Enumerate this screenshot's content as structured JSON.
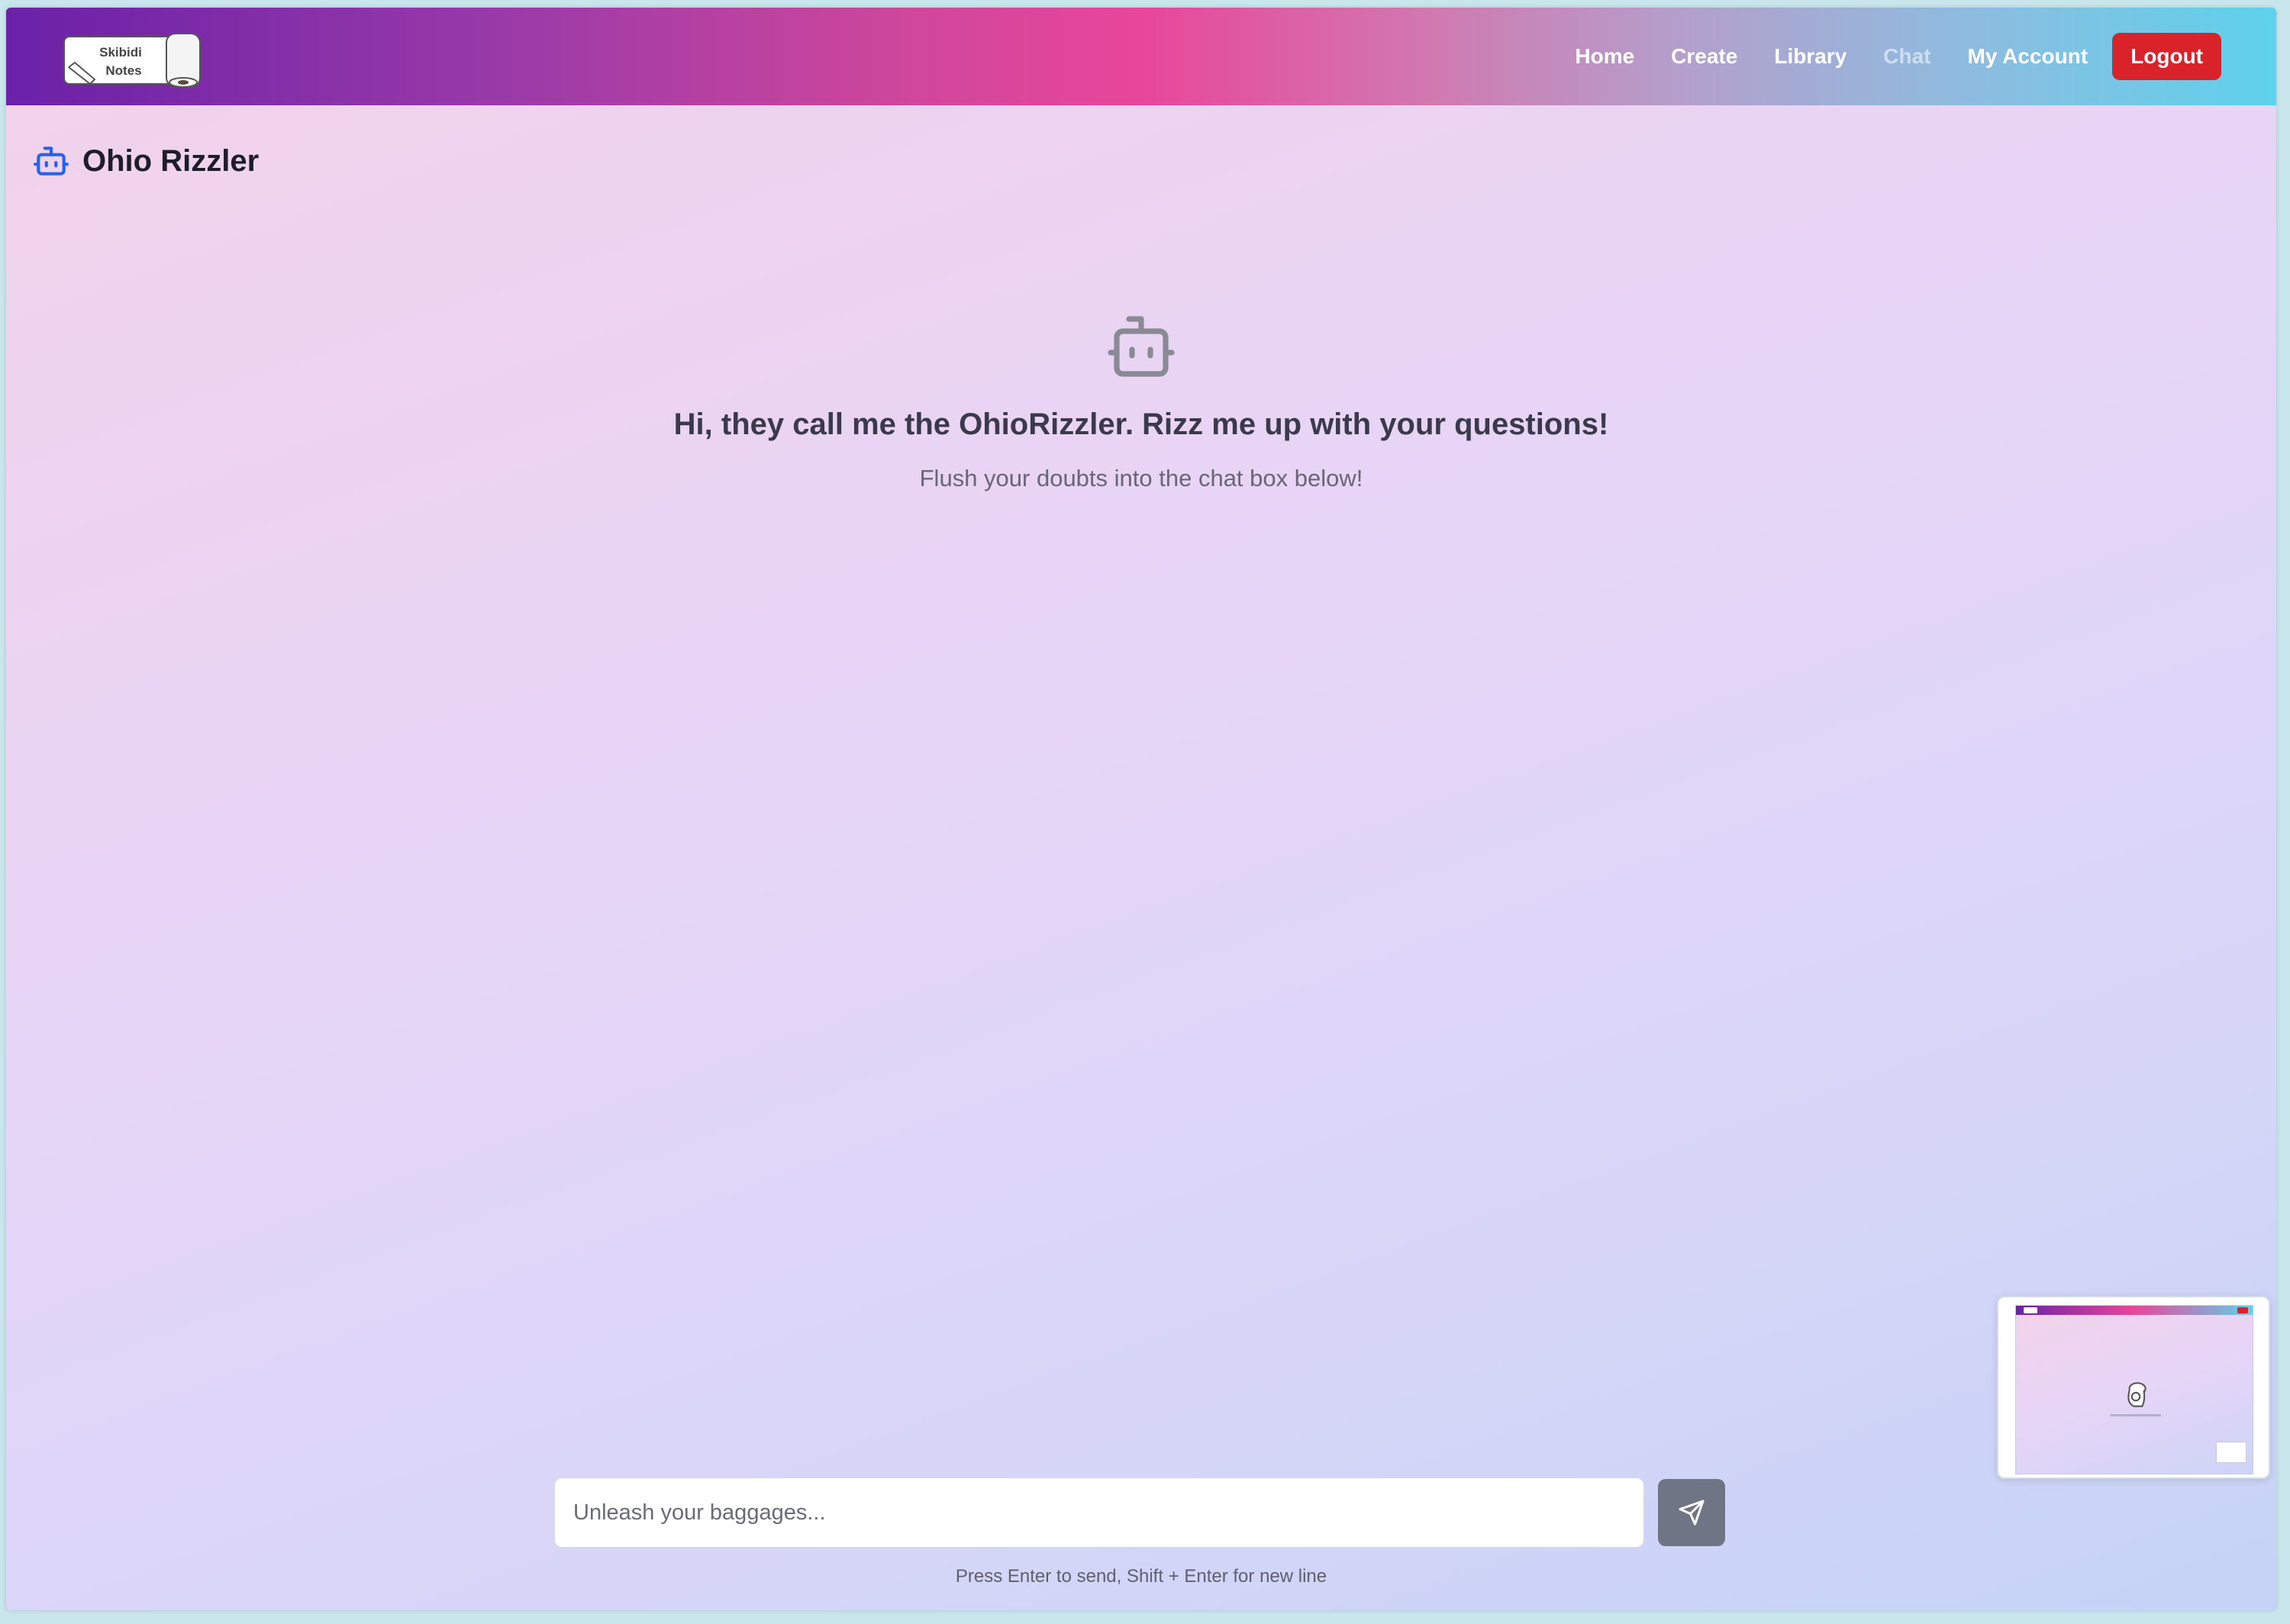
{
  "navbar": {
    "logo": {
      "line1": "Skibidi",
      "line2": "Notes"
    },
    "links": [
      {
        "label": "Home",
        "active": false
      },
      {
        "label": "Create",
        "active": false
      },
      {
        "label": "Library",
        "active": false
      },
      {
        "label": "Chat",
        "active": true
      },
      {
        "label": "My Account",
        "active": false
      }
    ],
    "logout_label": "Logout"
  },
  "page": {
    "title": "Ohio Rizzler",
    "title_icon": "bot-icon"
  },
  "welcome": {
    "icon": "bot-icon",
    "title": "Hi, they call me the OhioRizzler. Rizz me up with your questions!",
    "subtitle": "Flush your doubts into the chat box below!"
  },
  "composer": {
    "placeholder": "Unleash your baggages...",
    "value": "",
    "send_icon": "send-icon",
    "hint": "Press Enter to send, Shift + Enter for new line"
  },
  "colors": {
    "accent": "#2563eb",
    "logout": "#d9222a",
    "send_button": "#707585",
    "nav_active": "rgba(255,255,255,0.55)"
  }
}
